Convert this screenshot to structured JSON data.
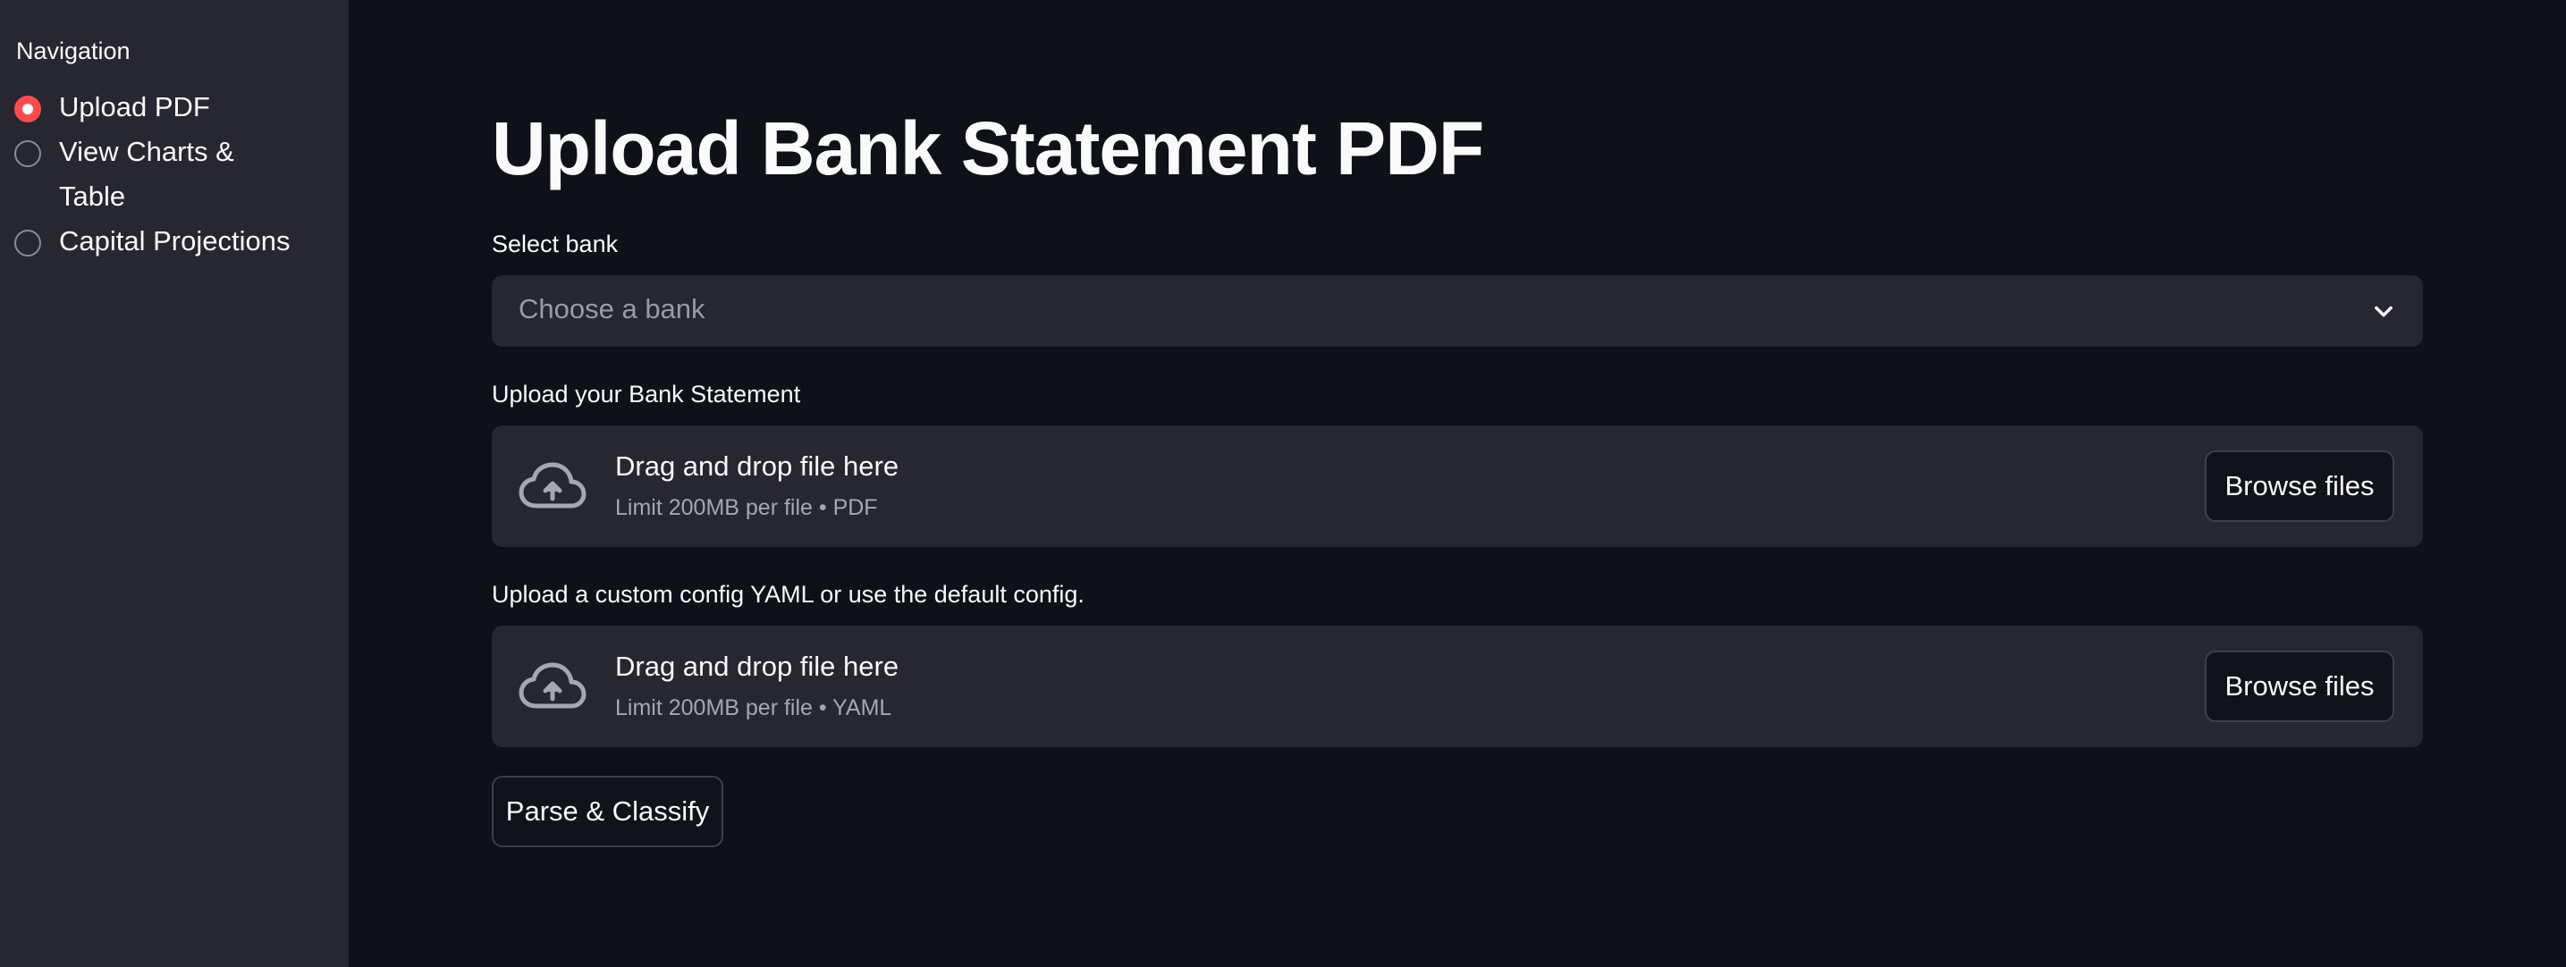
{
  "sidebar": {
    "title": "Navigation",
    "items": [
      {
        "label": "Upload PDF",
        "selected": true
      },
      {
        "label": "View Charts & Table",
        "selected": false
      },
      {
        "label": "Capital Projections",
        "selected": false
      }
    ]
  },
  "main": {
    "title": "Upload Bank Statement PDF",
    "bank_select": {
      "label": "Select bank",
      "placeholder": "Choose a bank",
      "icon": "chevron-down-icon"
    },
    "statement_upload": {
      "label": "Upload your Bank Statement",
      "dropzone_title": "Drag and drop file here",
      "dropzone_subtitle": "Limit 200MB per file • PDF",
      "button_label": "Browse files",
      "icon": "cloud-upload-icon"
    },
    "config_upload": {
      "label": "Upload a custom config YAML or use the default config.",
      "dropzone_title": "Drag and drop file here",
      "dropzone_subtitle": "Limit 200MB per file • YAML",
      "button_label": "Browse files",
      "icon": "cloud-upload-icon"
    },
    "parse_button_label": "Parse & Classify"
  },
  "colors": {
    "background": "#0e1117",
    "sidebar": "#262730",
    "widget": "#262730",
    "accent": "#ff4b4b",
    "text": "#fafafa",
    "muted_text": "#a3a8b4"
  }
}
